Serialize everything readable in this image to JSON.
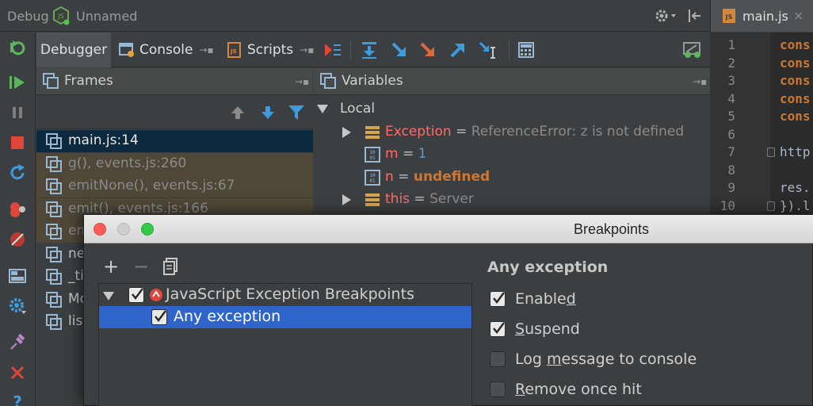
{
  "title_bar": {
    "debug_label": "Debug",
    "config_name": "Unnamed"
  },
  "editor": {
    "tab_label": "main.js",
    "close_glyph": "×",
    "line_numbers": [
      "1",
      "2",
      "3",
      "4",
      "5",
      "6",
      "7",
      "8",
      "9",
      "10"
    ],
    "lines": [
      "cons",
      "cons",
      "cons",
      "cons",
      "cons",
      "",
      "http",
      "",
      "res.",
      "}).l"
    ]
  },
  "debugger_tabs": {
    "debugger": "Debugger",
    "console": "Console",
    "scripts": "Scripts"
  },
  "frames": {
    "header": "Frames",
    "items": [
      {
        "label": "main.js:14",
        "state": "current"
      },
      {
        "label": "g(), events.js:260",
        "state": "library"
      },
      {
        "label": "emitNone(), events.js:67",
        "state": "library"
      },
      {
        "label": "emit(), events.js:166",
        "state": "library"
      },
      {
        "label": "en",
        "state": "library"
      },
      {
        "label": "ne",
        "state": "normal"
      },
      {
        "label": "_ti",
        "state": "normal"
      },
      {
        "label": "Mo",
        "state": "normal"
      },
      {
        "label": "list",
        "state": "normal"
      }
    ]
  },
  "variables": {
    "header": "Variables",
    "local_label": "Local",
    "items": [
      {
        "name": "Exception",
        "eq": " = ",
        "value": "ReferenceError: z is not defined",
        "kind": "object",
        "expandable": true
      },
      {
        "name": "m",
        "eq": " = ",
        "value": "1",
        "kind": "number",
        "expandable": false
      },
      {
        "name": "n",
        "eq": " = ",
        "value": "undefined",
        "kind": "undefined",
        "expandable": false
      },
      {
        "name": "this",
        "eq": " = ",
        "value": "Server",
        "kind": "object",
        "expandable": true
      }
    ]
  },
  "dialog": {
    "title": "Breakpoints",
    "toolbar": {
      "add": "+",
      "remove": "−"
    },
    "tree": {
      "group_label": "JavaScript Exception Breakpoints",
      "item_label": "Any exception"
    },
    "details": {
      "title": "Any exception",
      "enabled": {
        "pre": "Enable",
        "ul": "d",
        "post": "",
        "checked": true
      },
      "suspend": {
        "pre": "",
        "ul": "S",
        "post": "uspend",
        "checked": true
      },
      "log_message": {
        "pre": "Log ",
        "ul": "m",
        "post": "essage to console",
        "checked": false
      },
      "remove_once_hit": {
        "pre": "",
        "ul": "R",
        "post": "emove once hit",
        "checked": false
      }
    }
  },
  "colors": {
    "background": "#3c3f41",
    "selection": "#2f65ca",
    "current_frame": "#0d293e",
    "library_frame": "#4f4838",
    "variable_name": "#ff6b68",
    "keyword": "#cc7832",
    "number": "#6897bb"
  }
}
